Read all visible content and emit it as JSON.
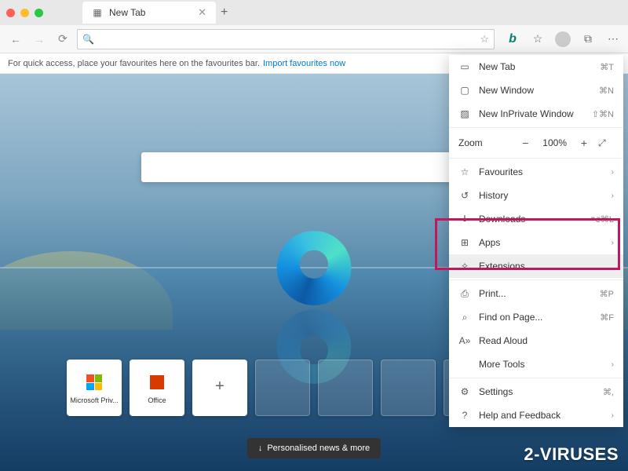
{
  "titlebar": {
    "tab_title": "New Tab"
  },
  "toolbar": {
    "address_value": ""
  },
  "favbar": {
    "text": "For quick access, place your favourites here on the favourites bar.",
    "link": "Import favourites now"
  },
  "search": {
    "placeholder": ""
  },
  "tiles": [
    {
      "label": "Microsoft Priv..."
    },
    {
      "label": "Office"
    },
    {
      "label": "+"
    }
  ],
  "news_pill": "Personalised news & more",
  "menu": {
    "new_tab": {
      "label": "New Tab",
      "shortcut": "⌘T"
    },
    "new_window": {
      "label": "New Window",
      "shortcut": "⌘N"
    },
    "new_inprivate": {
      "label": "New InPrivate Window",
      "shortcut": "⇧⌘N"
    },
    "zoom": {
      "label": "Zoom",
      "value": "100%"
    },
    "favourites": {
      "label": "Favourites"
    },
    "history": {
      "label": "History"
    },
    "downloads": {
      "label": "Downloads",
      "shortcut": "⌥⌘L"
    },
    "apps": {
      "label": "Apps"
    },
    "extensions": {
      "label": "Extensions"
    },
    "print": {
      "label": "Print...",
      "shortcut": "⌘P"
    },
    "find": {
      "label": "Find on Page...",
      "shortcut": "⌘F"
    },
    "read_aloud": {
      "label": "Read Aloud"
    },
    "more_tools": {
      "label": "More Tools"
    },
    "settings": {
      "label": "Settings",
      "shortcut": "⌘,"
    },
    "help": {
      "label": "Help and Feedback"
    }
  },
  "watermark": "2-VIRUSES"
}
